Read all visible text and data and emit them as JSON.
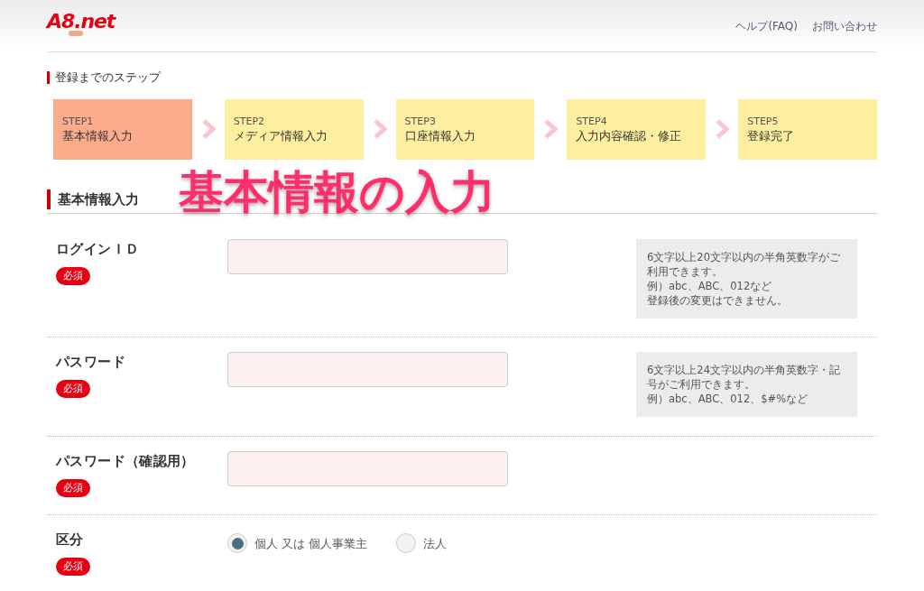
{
  "header": {
    "logo": "A8.net",
    "links": [
      "ヘルプ(FAQ)",
      "お問い合わせ"
    ]
  },
  "steps_title": "登録までのステップ",
  "steps": [
    {
      "number": "STEP1",
      "label": "基本情報入力",
      "selected": true
    },
    {
      "number": "STEP2",
      "label": "メディア情報入力",
      "selected": false
    },
    {
      "number": "STEP3",
      "label": "口座情報入力",
      "selected": false
    },
    {
      "number": "STEP4",
      "label": "入力内容確認・修正",
      "selected": false
    },
    {
      "number": "STEP5",
      "label": "登録完了",
      "selected": false
    }
  ],
  "section_title": "基本情報入力",
  "overlay_caption": "基本情報の入力",
  "fields": [
    {
      "kind": "text",
      "label": "ログインＩＤ",
      "badge": "必須",
      "hint": [
        "6文字以上20文字以内の半角英数字がご利用できます。",
        "例）abc、ABC、012など",
        "登録後の変更はできません。"
      ]
    },
    {
      "kind": "text",
      "label": "パスワード",
      "badge": "必須",
      "hint": [
        "6文字以上24文字以内の半角英数字・記号がご利用できます。",
        "例）abc、ABC、012、$#%など"
      ]
    },
    {
      "kind": "text",
      "label": "パスワード（確認用）",
      "badge": "必須"
    },
    {
      "kind": "radio",
      "label": "区分",
      "badge": "必須",
      "options": [
        {
          "label": "個人 又は 個人事業主",
          "selected": true
        },
        {
          "label": "法人",
          "selected": false
        }
      ]
    }
  ]
}
